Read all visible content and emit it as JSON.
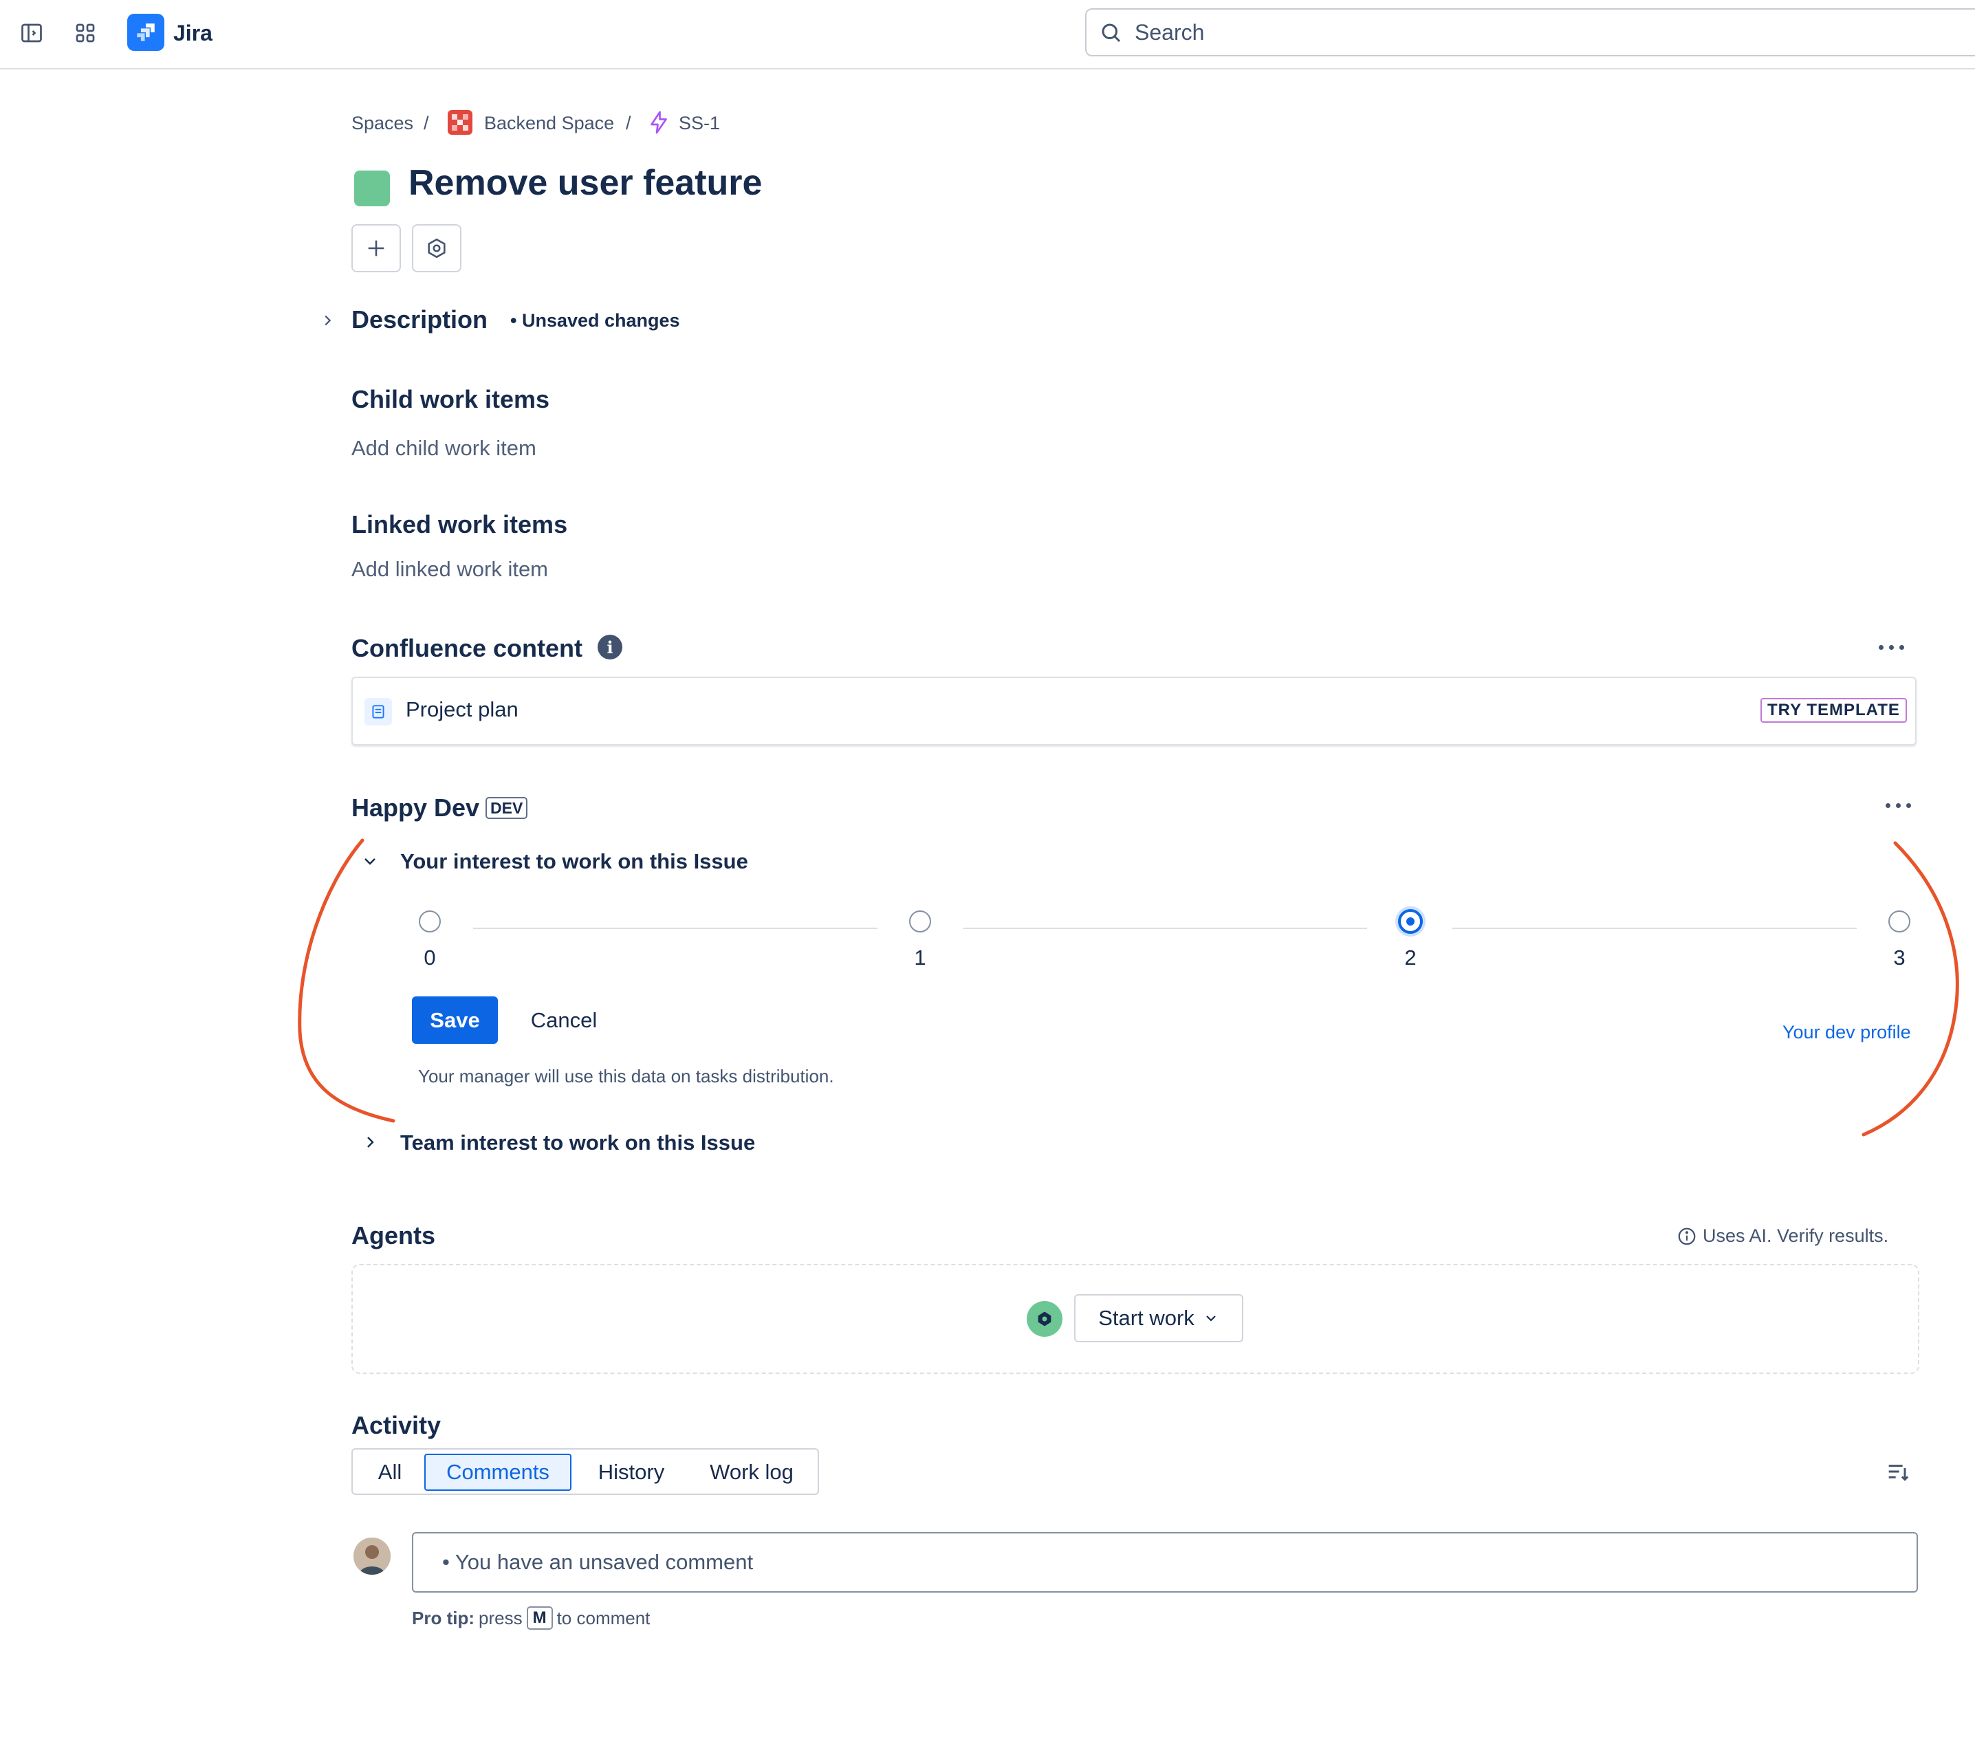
{
  "topbar": {
    "app_name": "Jira",
    "search_placeholder": "Search"
  },
  "breadcrumb": {
    "items": [
      "Spaces",
      "Backend Space",
      "SS-1"
    ],
    "separator": "/"
  },
  "issue": {
    "title": "Remove user feature",
    "type_color": "#6cc795"
  },
  "description": {
    "title": "Description",
    "unsaved": "• Unsaved changes"
  },
  "child_items": {
    "title": "Child work items",
    "placeholder": "Add child work item"
  },
  "linked_items": {
    "title": "Linked work items",
    "placeholder": "Add linked work item"
  },
  "confluence": {
    "title": "Confluence content",
    "info_icon": "i",
    "item": "Project plan",
    "try_template": "TRY TEMPLATE"
  },
  "happy_dev": {
    "title": "Happy Dev",
    "badge": "DEV",
    "interest_title": "Your interest to work on this Issue",
    "options": [
      "0",
      "1",
      "2",
      "3"
    ],
    "selected": "2",
    "save": "Save",
    "cancel": "Cancel",
    "dev_profile": "Your dev profile",
    "helper": "Your manager will use this data on tasks distribution.",
    "team_title": "Team interest to work on this Issue"
  },
  "agents": {
    "title": "Agents",
    "ai_note": "Uses AI. Verify results.",
    "start_work": "Start work"
  },
  "activity": {
    "title": "Activity",
    "tabs": [
      "All",
      "Comments",
      "History",
      "Work log"
    ],
    "active_tab": "Comments",
    "comment_placeholder": "• You have an unsaved comment",
    "protip_label": "Pro tip:",
    "protip_press": "press",
    "protip_key": "M",
    "protip_suffix": "to comment"
  },
  "colors": {
    "accent": "#0c66e4",
    "annotation": "#e8542a",
    "space_icon": "#e2483d"
  }
}
